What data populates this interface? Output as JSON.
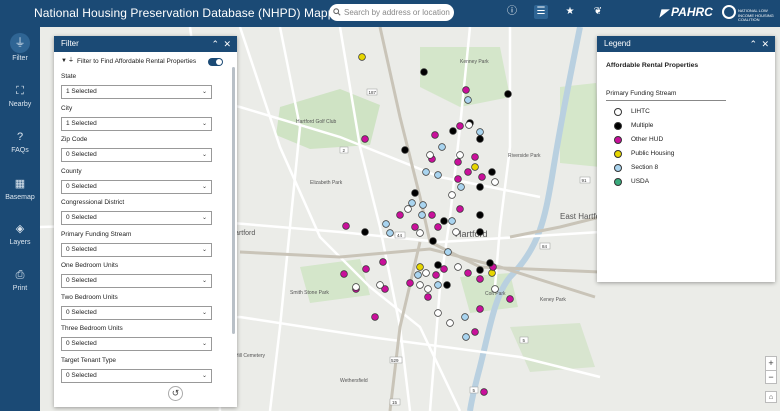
{
  "header": {
    "title": "National Housing Preservation Database (NHPD) Mapping Tool",
    "search_placeholder": "Search by address or location",
    "logo_pahrc": "PAHRC",
    "logo_nlihc": "NATIONAL LOW INCOME HOUSING COALITION"
  },
  "icons": {
    "info": "info-icon",
    "list": "list-icon",
    "star": "star-icon",
    "gift": "gift-icon"
  },
  "rail": {
    "items": [
      {
        "label": "Filter",
        "icon": "filter-icon"
      },
      {
        "label": "Nearby",
        "icon": "nearby-icon"
      },
      {
        "label": "FAQs",
        "icon": "question-icon"
      },
      {
        "label": "Basemap",
        "icon": "grid-icon"
      },
      {
        "label": "Layers",
        "icon": "layers-icon"
      },
      {
        "label": "Print",
        "icon": "print-icon"
      }
    ]
  },
  "filter": {
    "title": "Filter",
    "toggle_label": "Filter to Find Affordable Rental Properties",
    "fields": [
      {
        "label": "State",
        "value": "1 Selected"
      },
      {
        "label": "City",
        "value": "1 Selected"
      },
      {
        "label": "Zip Code",
        "value": "0 Selected"
      },
      {
        "label": "County",
        "value": "0 Selected"
      },
      {
        "label": "Congressional District",
        "value": "0 Selected"
      },
      {
        "label": "Primary Funding Stream",
        "value": "0 Selected"
      },
      {
        "label": "One Bedroom Units",
        "value": "0 Selected"
      },
      {
        "label": "Two Bedroom Units",
        "value": "0 Selected"
      },
      {
        "label": "Three Bedroom Units",
        "value": "0 Selected"
      },
      {
        "label": "Target Tenant Type",
        "value": "0 Selected"
      }
    ]
  },
  "legend": {
    "title": "Legend",
    "heading": "Affordable Rental Properties",
    "subheading": "Primary Funding Stream",
    "items": [
      {
        "label": "LIHTC",
        "color": "#ffffff"
      },
      {
        "label": "Multiple",
        "color": "#000000"
      },
      {
        "label": "Other HUD",
        "color": "#c8109a"
      },
      {
        "label": "Public Housing",
        "color": "#e6d600"
      },
      {
        "label": "Section 8",
        "color": "#a9d4ef"
      },
      {
        "label": "USDA",
        "color": "#3aaa7c"
      }
    ]
  },
  "map": {
    "labels": [
      "Hartford",
      "Hartford",
      "East Hartford",
      "Hartford Golf Club",
      "Kenney Park",
      "Elizabeth Park",
      "Riverside Park",
      "Smith Stone Park",
      "Colt Park",
      "Keney Park",
      "Wethersfield",
      "Cedar Hill Cemetery"
    ],
    "road_numbers": [
      "187",
      "44",
      "84",
      "2",
      "5",
      "529",
      "15",
      "5",
      "91"
    ]
  },
  "zoom": {
    "in": "+",
    "out": "−"
  }
}
